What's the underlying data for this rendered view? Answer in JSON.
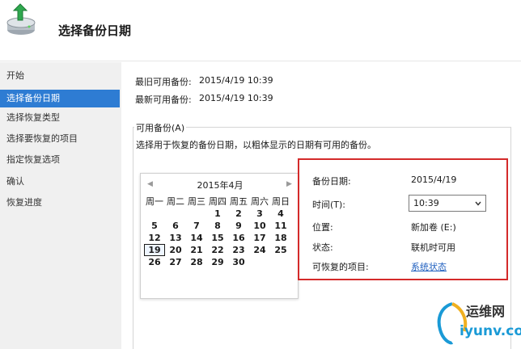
{
  "header": {
    "title": "选择备份日期",
    "icon": "backup-restore-icon"
  },
  "sidebar": {
    "items": [
      {
        "label": "开始",
        "active": false
      },
      {
        "label": "选择备份日期",
        "active": true
      },
      {
        "label": "选择恢复类型",
        "active": false
      },
      {
        "label": "选择要恢复的项目",
        "active": false
      },
      {
        "label": "指定恢复选项",
        "active": false
      },
      {
        "label": "确认",
        "active": false
      },
      {
        "label": "恢复进度",
        "active": false
      }
    ]
  },
  "main": {
    "oldest_label": "最旧可用备份:",
    "oldest_value": "2015/4/19 10:39",
    "latest_label": "最新可用备份:",
    "latest_value": "2015/4/19 10:39",
    "group_title": "可用备份(A)",
    "instruction": "选择用于恢复的备份日期，以粗体显示的日期有可用的备份。"
  },
  "calendar": {
    "title": "2015年4月",
    "prev": "◀",
    "next": "▶",
    "weekdays": [
      "周一",
      "周二",
      "周三",
      "周四",
      "周五",
      "周六",
      "周日"
    ],
    "weeks": [
      [
        "",
        "",
        "",
        "1",
        "2",
        "3",
        "4",
        "5"
      ],
      [
        "6",
        "7",
        "8",
        "9",
        "10",
        "11",
        "12"
      ],
      [
        "13",
        "14",
        "15",
        "16",
        "17",
        "18",
        "19"
      ],
      [
        "20",
        "21",
        "22",
        "23",
        "24",
        "25",
        "26"
      ],
      [
        "27",
        "28",
        "29",
        "30",
        "",
        "",
        ""
      ]
    ],
    "selected": "19"
  },
  "details": {
    "date_label": "备份日期:",
    "date_value": "2015/4/19",
    "time_label": "时间(T):",
    "time_value": "10:39",
    "location_label": "位置:",
    "location_value": "新加卷 (E:)",
    "status_label": "状态:",
    "status_value": "联机时可用",
    "items_label": "可恢复的项目:",
    "items_link": "系统状态"
  },
  "watermark": {
    "line1": "运维网",
    "line2": "iyunv.com"
  },
  "colors": {
    "accent": "#2e7cd3",
    "highlight_border": "#d42a2a",
    "link": "#1f5fbf"
  }
}
